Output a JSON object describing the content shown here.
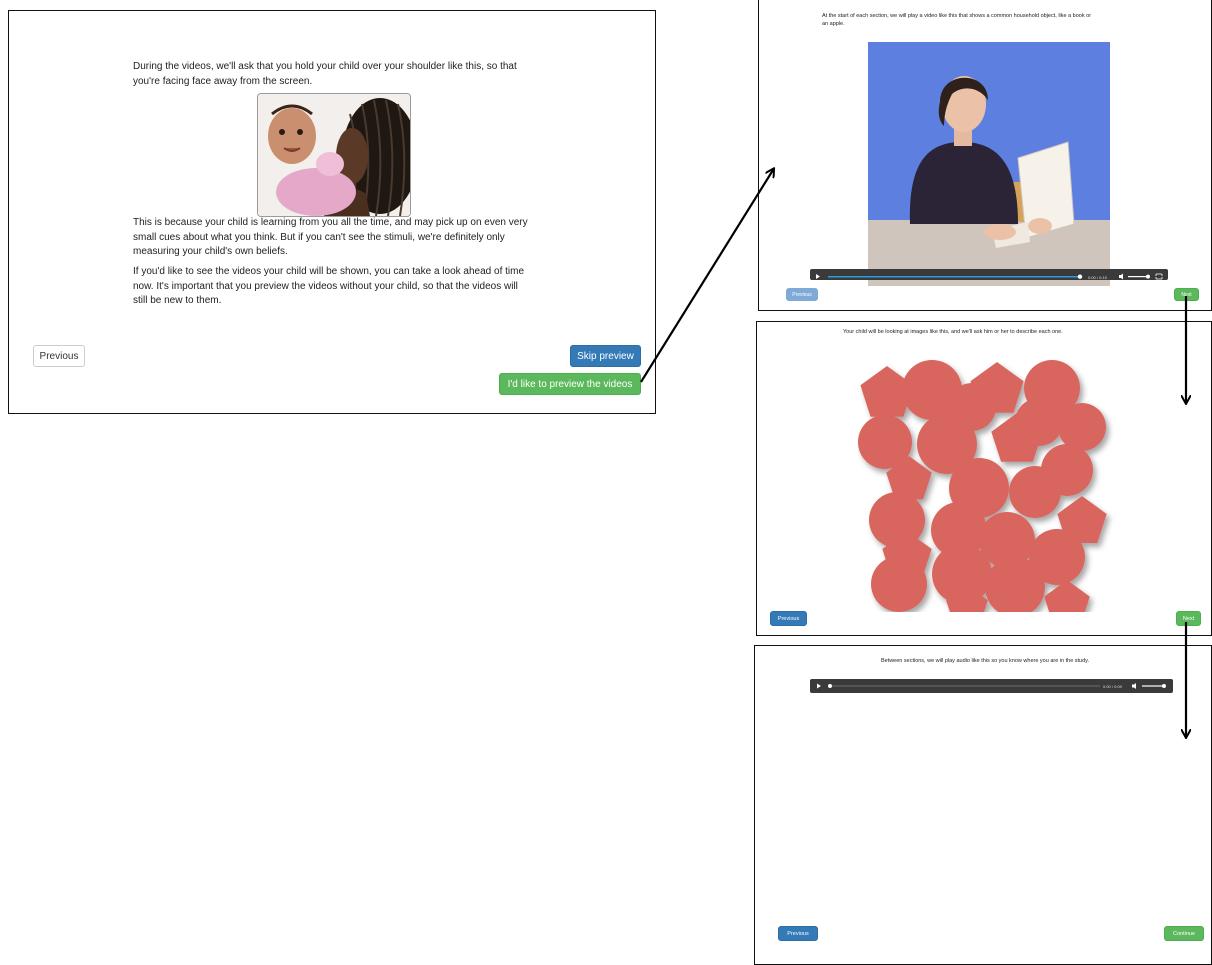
{
  "panel_main": {
    "intro_text": "During the videos, we'll ask that you hold your child over your shoulder like this, so that you're facing face away from the screen.",
    "para1": "This is because your child is learning from you all the time, and may pick up on even very small cues about what you think. But if you can't see the stimuli, we're definitely only measuring your child's own beliefs.",
    "para2": "If you'd like to see the videos your child will be shown, you can take a look ahead of time now. It's important that you preview the videos without your child, so that the videos will still be new to them.",
    "previous_label": "Previous",
    "skip_label": "Skip preview",
    "preview_label": "I'd like to preview the videos"
  },
  "panel_video": {
    "text": "At the start of each section, we will play a video like this that shows a common household object, like a book or an apple.",
    "time": "0:00 / 0:15",
    "previous_label": "Previous",
    "next_label": "Next"
  },
  "panel_images": {
    "text": "Your child will be looking at images like this, and we'll ask him or her to describe each one.",
    "previous_label": "Previous",
    "next_label": "Next"
  },
  "panel_audio": {
    "text": "Between sections, we will play audio like this so you know where you are in the study.",
    "time": "0:00 / 0:09",
    "previous_label": "Previous",
    "continue_label": "Continue"
  },
  "colors": {
    "shape_fill": "#d9655f",
    "video_bg": "#5c7fe0",
    "primary": "#337ab7",
    "success": "#5cb85c"
  }
}
